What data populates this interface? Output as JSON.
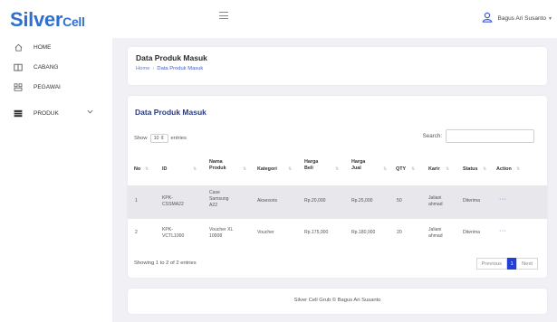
{
  "brand": {
    "name_main": "Silver",
    "name_sub": "Cell"
  },
  "sidebar": {
    "items": [
      {
        "label": "HOME",
        "icon": "home-icon"
      },
      {
        "label": "CABANG",
        "icon": "store-icon"
      },
      {
        "label": "PEGAWAI",
        "icon": "employee-icon"
      },
      {
        "label": "PRODUK",
        "icon": "product-icon",
        "expandable": true
      }
    ]
  },
  "header": {
    "user_name": "Bagus Ari Susanto"
  },
  "breadcrumb_card": {
    "title": "Data Produk Masuk",
    "crumbs": [
      "Home",
      "Data Produk Masuk"
    ]
  },
  "table_card": {
    "title": "Data Produk Masuk",
    "show_label": "Show",
    "entries_value": "10",
    "entries_label": "entries",
    "search_label": "Search:",
    "search_value": "",
    "columns": [
      "No",
      "ID",
      "Nama Produk",
      "Kategori",
      "Harga Beli",
      "Harga Jual",
      "QTY",
      "Karir",
      "Status",
      "Action"
    ],
    "rows": [
      {
        "no": "1",
        "id": "KPK-CSSMA22",
        "nama": "Case Samsung A22",
        "kategori": "Aksesoris",
        "beli": "Rp.20,000",
        "jual": "Rp.25,000",
        "qty": "50",
        "karir": "Jaliani ahmad",
        "status": "Diterima",
        "action": "···"
      },
      {
        "no": "2",
        "id": "KPK-VCTL1000",
        "nama": "Voucher XL 10008",
        "kategori": "Voucher",
        "beli": "Rp.175,000",
        "jual": "Rp.180,000",
        "qty": "20",
        "karir": "Jaliani ahmad",
        "status": "Diterima",
        "action": "···"
      }
    ],
    "showing_text": "Showing 1 to 2 of 2 entries",
    "pagination": {
      "previous": "Previous",
      "current": "1",
      "next": "Next"
    }
  },
  "footer": {
    "text": "Silver Cell Grub © Bagus Ari Susanto"
  },
  "colors": {
    "accent": "#2f6fcf",
    "pager_active": "#2240d8",
    "title_blue": "#2a3b83"
  }
}
